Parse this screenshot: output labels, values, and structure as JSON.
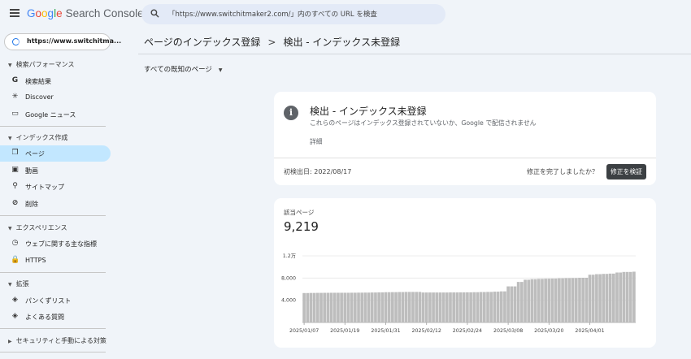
{
  "header": {
    "logo": {
      "g": "G",
      "o1": "o",
      "o2": "o",
      "g2": "g",
      "l": "l",
      "e": "e",
      "product": "Search Console"
    },
    "search": {
      "placeholder": "「https://www.switchitmaker2.com/」内のすべての URL を検査"
    },
    "icons": {
      "menu": "menu-icon",
      "search": "search-icon"
    }
  },
  "sidebar": {
    "property": {
      "label": "https://www.switchitma...",
      "chevron": "▾"
    },
    "sections": [
      {
        "label": "検索パフォーマンス",
        "items": [
          {
            "label": "検索結果",
            "icon": "G"
          },
          {
            "label": "Discover",
            "icon": "✳"
          },
          {
            "label": "Google ニュース",
            "icon": "▭"
          }
        ]
      },
      {
        "label": "インデックス作成",
        "items": [
          {
            "label": "ページ",
            "icon": "❐"
          },
          {
            "label": "動画",
            "icon": "▣"
          },
          {
            "label": "サイトマップ",
            "icon": "⚲"
          },
          {
            "label": "削除",
            "icon": "⊘"
          }
        ]
      },
      {
        "label": "エクスペリエンス",
        "items": [
          {
            "label": "ウェブに関する主な指標",
            "icon": "◷"
          },
          {
            "label": "HTTPS",
            "icon": "🔒"
          }
        ]
      },
      {
        "label": "拡張",
        "items": [
          {
            "label": "パンくずリスト",
            "icon": "◈"
          },
          {
            "label": "よくある質問",
            "icon": "◈"
          }
        ]
      },
      {
        "label": "セキュリティと手動による対策",
        "items": []
      }
    ]
  },
  "main": {
    "breadcrumb": {
      "parent": "ページのインデックス登録",
      "separator": ">",
      "current": "検出 - インデックス未登録"
    },
    "filter": {
      "label": "すべての既知のページ",
      "arrow": "▼"
    },
    "issue_card": {
      "icon": "i",
      "title": "検出 - インデックス未登録",
      "subtitle": "これらのページはインデックス登録されていないか、Google で配信されません",
      "details_link": "詳細",
      "first_detected": "初検出日: 2022/08/17",
      "fix_question": "修正を完了しましたか？",
      "validate_button": "修正を検証"
    },
    "stats_card": {
      "label": "該当ページ",
      "value": "9,219"
    }
  },
  "chart_data": {
    "type": "bar",
    "title": "",
    "xlabel": "",
    "ylabel": "",
    "ylim": [
      0,
      12000
    ],
    "yticks": [
      {
        "value": 4000,
        "label": "4,000"
      },
      {
        "value": 8000,
        "label": "8,000"
      },
      {
        "value": 12000,
        "label": "1.2万"
      }
    ],
    "xtick_labels": [
      "2025/01/07",
      "2025/01/19",
      "2025/01/31",
      "2025/02/12",
      "2025/02/24",
      "2025/03/08",
      "2025/03/20",
      "2025/04/01"
    ],
    "xtick_indices": [
      0,
      12,
      24,
      36,
      48,
      60,
      72,
      84
    ],
    "bar_color": "#bdbdbd",
    "start_date": "2025/01/07",
    "values": [
      5300,
      5300,
      5320,
      5320,
      5330,
      5330,
      5340,
      5340,
      5350,
      5350,
      5350,
      5350,
      5350,
      5350,
      5360,
      5360,
      5370,
      5370,
      5380,
      5380,
      5400,
      5400,
      5420,
      5420,
      5450,
      5450,
      5460,
      5460,
      5480,
      5480,
      5500,
      5500,
      5500,
      5500,
      5500,
      5400,
      5400,
      5400,
      5400,
      5400,
      5400,
      5400,
      5400,
      5410,
      5410,
      5410,
      5420,
      5420,
      5430,
      5430,
      5450,
      5450,
      5480,
      5480,
      5500,
      5500,
      5550,
      5550,
      5600,
      5600,
      6500,
      6500,
      6500,
      7300,
      7300,
      7700,
      7700,
      7800,
      7800,
      7850,
      7850,
      7880,
      7880,
      7900,
      7900,
      7950,
      7950,
      7980,
      7980,
      8000,
      8000,
      8050,
      8050,
      8050,
      8600,
      8600,
      8700,
      8700,
      8750,
      8750,
      8800,
      8800,
      9000,
      9000,
      9100,
      9100,
      9100,
      9150
    ]
  }
}
